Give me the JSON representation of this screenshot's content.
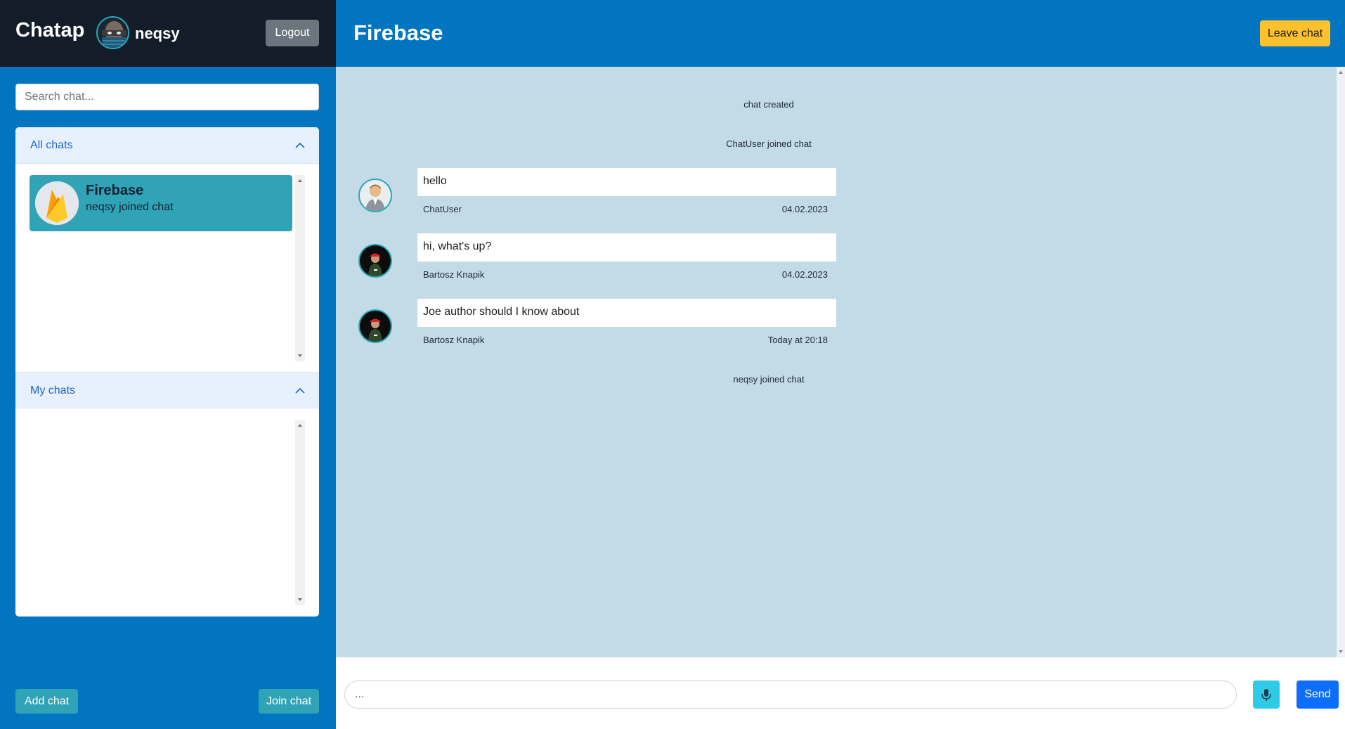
{
  "app": {
    "title": "Chatap"
  },
  "user": {
    "name": "neqsy",
    "avatar_icon": "user-avatar-masked"
  },
  "sidebar": {
    "logout_label": "Logout",
    "search_placeholder": "Search chat...",
    "sections": [
      {
        "title": "All chats",
        "expanded": true,
        "chats": [
          {
            "name": "Firebase",
            "last_message": "neqsy joined chat",
            "icon": "firebase-flame-icon",
            "selected": true
          }
        ]
      },
      {
        "title": "My chats",
        "expanded": true,
        "chats": []
      }
    ],
    "add_chat_label": "Add chat",
    "join_chat_label": "Join chat"
  },
  "main": {
    "title": "Firebase",
    "leave_label": "Leave chat",
    "messages": [
      {
        "type": "system",
        "text": "chat created"
      },
      {
        "type": "system",
        "text": "ChatUser joined chat"
      },
      {
        "type": "user",
        "author": "ChatUser",
        "text": "hello",
        "date": "04.02.2023",
        "avatar_icon": "default-user-avatar"
      },
      {
        "type": "user",
        "author": "Bartosz Knapik",
        "text": "hi, what's up?",
        "date": "04.02.2023",
        "avatar_icon": "user-avatar-red-cap"
      },
      {
        "type": "user",
        "author": "Bartosz Knapik",
        "text": "Joe author should I know about",
        "date": "Today at 20:18",
        "avatar_icon": "user-avatar-red-cap"
      },
      {
        "type": "system",
        "text": "neqsy joined chat"
      }
    ],
    "composer": {
      "placeholder": "...",
      "mic_icon": "microphone-icon",
      "send_label": "Send"
    }
  },
  "colors": {
    "sidebar_bg": "#0275c1",
    "header_dark": "#151c29",
    "accent_teal": "#30a3b6",
    "messages_bg": "#c3dbe7",
    "leave_button": "#fec02d",
    "send_button": "#0d6efd",
    "mic_button": "#2ecbe7",
    "logout_button": "#6c757d"
  }
}
